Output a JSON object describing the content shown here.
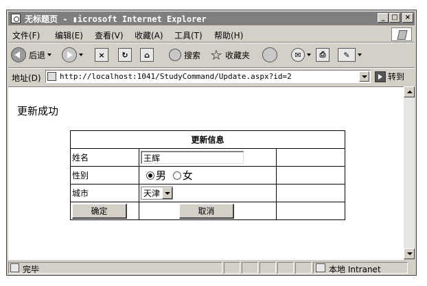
{
  "window": {
    "title": "无标题页 - ▮icrosoft Internet Explorer"
  },
  "caption_buttons": {
    "minimize": "_",
    "maximize": "□",
    "close": "×"
  },
  "menu": [
    {
      "label": "文件(F)"
    },
    {
      "label": "编辑(E)"
    },
    {
      "label": "查看(V)"
    },
    {
      "label": "收藏(A)"
    },
    {
      "label": "工具(T)"
    },
    {
      "label": "帮助(H)"
    }
  ],
  "toolbar": {
    "back_label": "后退",
    "search_label": "搜索",
    "favorites_label": "收藏夹"
  },
  "address": {
    "label": "地址(D)",
    "url": "http://localhost:1041/StudyCommand/Update.aspx?id=2",
    "go_label": "转到"
  },
  "page": {
    "message": "更新成功",
    "form": {
      "title": "更新信息",
      "name_label": "姓名",
      "name_value": "王辉",
      "gender_label": "性别",
      "gender_options": [
        "男",
        "女"
      ],
      "gender_selected": "男",
      "city_label": "城市",
      "city_value": "天津",
      "ok_label": "确定",
      "cancel_label": "取消"
    }
  },
  "status": {
    "text": "完毕",
    "zone": "本地 Intranet"
  }
}
